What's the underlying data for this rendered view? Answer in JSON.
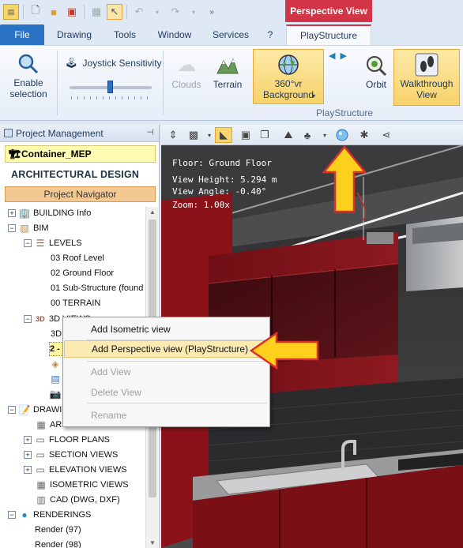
{
  "app": {
    "context_tab_title": "Perspective View"
  },
  "tabs": [
    {
      "label": "File"
    },
    {
      "label": "Drawing"
    },
    {
      "label": "Tools"
    },
    {
      "label": "Window"
    },
    {
      "label": "Services"
    },
    {
      "label": "?"
    },
    {
      "label": "PlayStructure"
    }
  ],
  "ribbon": {
    "enable_selection": "Enable\nselection",
    "joystick_label": "Joystick Sensitivity",
    "joystick_value": 0.5,
    "clouds": "Clouds",
    "terrain": "Terrain",
    "background": "360°vr\nBackground",
    "orbit": "Orbit",
    "walkthrough": "Walkthrough\nView",
    "group_label": "PlayStructure"
  },
  "panel": {
    "title": "Project Management",
    "container": "Container_MEP",
    "section_title": "ARCHITECTURAL DESIGN",
    "navigator": "Project Navigator"
  },
  "tree": [
    {
      "label": "BUILDING Info"
    },
    {
      "label": "BIM"
    },
    {
      "label": "LEVELS"
    },
    {
      "label": "03 Roof Level"
    },
    {
      "label": "02 Ground Floor"
    },
    {
      "label": "01 Sub-Structure (found"
    },
    {
      "label": "00 TERRAIN"
    },
    {
      "label": "3D VIEWS"
    },
    {
      "label": "3D"
    },
    {
      "label": "2 -"
    },
    {
      "label": "DRAWINGS"
    },
    {
      "label": "AR"
    },
    {
      "label": "FLOOR PLANS"
    },
    {
      "label": "SECTION VIEWS"
    },
    {
      "label": "ELEVATION VIEWS"
    },
    {
      "label": "ISOMETRIC VIEWS"
    },
    {
      "label": "CAD (DWG, DXF)"
    },
    {
      "label": "RENDERINGS"
    },
    {
      "label": "Render (97)"
    },
    {
      "label": "Render (98)"
    }
  ],
  "viewport": {
    "floor": "Floor: Ground Floor",
    "height": "View Height: 5.294 m",
    "angle": "View Angle: -0.40°",
    "zoom": "Zoom: 1.00x"
  },
  "context_menu": [
    {
      "label": "Add Isometric view"
    },
    {
      "label": "Add Perspective view (PlayStructure)"
    },
    {
      "label": "Add View"
    },
    {
      "label": "Delete View"
    },
    {
      "label": "Rename"
    }
  ],
  "colors": {
    "accent": "#d23546",
    "file_tab": "#2a72c4",
    "highlight": "#f9d56e",
    "arrow": "#fdd01d"
  }
}
